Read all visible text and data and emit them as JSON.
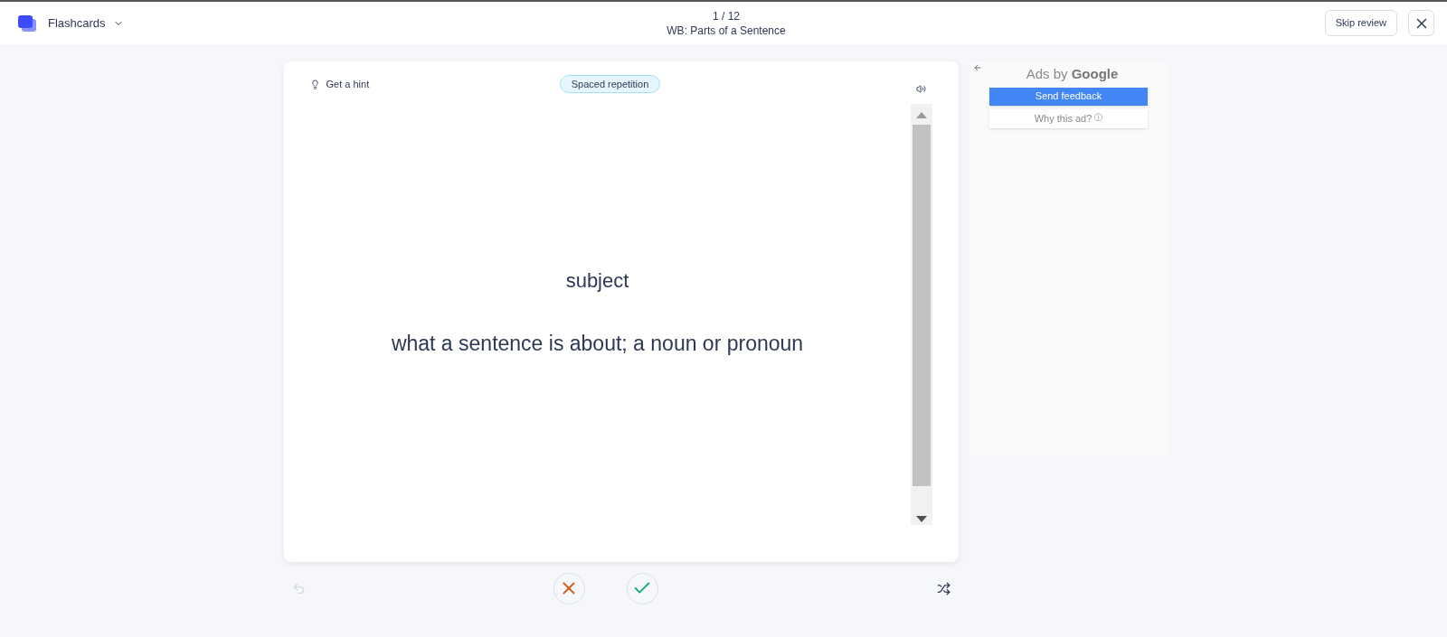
{
  "header": {
    "app_menu": "Flashcards",
    "progress": "1 / 12",
    "set_title": "WB: Parts of a Sentence",
    "skip_button": "Skip review"
  },
  "card": {
    "hint": "Get a hint",
    "badge": "Spaced repetition",
    "term": "subject",
    "definition": "what a sentence is about; a noun or pronoun"
  },
  "controls": {
    "undo_disabled": true
  },
  "ad": {
    "label": "Ads by ",
    "brand": "Google",
    "feedback_button": "Send feedback",
    "why_button": "Why this ad?",
    "why_icon": "ⓘ"
  }
}
